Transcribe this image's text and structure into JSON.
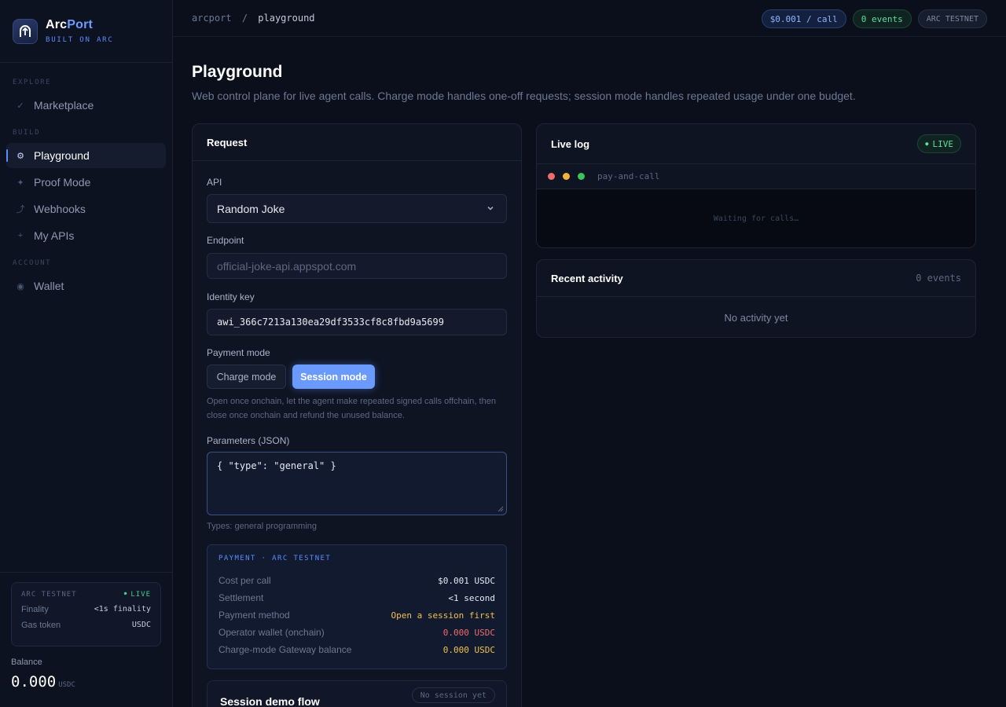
{
  "brand": {
    "name_a": "Arc",
    "name_b": "Port",
    "tagline": "BUILT ON ARC"
  },
  "nav": {
    "explore_header": "EXPLORE",
    "build_header": "BUILD",
    "account_header": "ACCOUNT",
    "items": [
      {
        "label": "Marketplace",
        "icon": "check-icon"
      },
      {
        "label": "Playground",
        "icon": "gear-icon"
      },
      {
        "label": "Proof Mode",
        "icon": "sparkle-icon"
      },
      {
        "label": "Webhooks",
        "icon": "arrow-icon"
      },
      {
        "label": "My APIs",
        "icon": "plus-icon"
      },
      {
        "label": "Wallet",
        "icon": "wallet-icon"
      }
    ]
  },
  "network": {
    "name": "ARC TESTNET",
    "status": "LIVE",
    "finality_label": "Finality",
    "finality_value": "<1s finality",
    "gas_label": "Gas token",
    "gas_value": "USDC"
  },
  "balance": {
    "label": "Balance",
    "value": "0.000",
    "unit": "USDC"
  },
  "breadcrumb": {
    "root": "arcport",
    "separator": "/",
    "current": "playground"
  },
  "header_pills": {
    "price": "$0.001 / call",
    "events": "0 events",
    "network": "ARC TESTNET"
  },
  "page": {
    "title": "Playground",
    "subtitle": "Web control plane for live agent calls. Charge mode handles one-off requests; session mode handles repeated usage under one budget."
  },
  "request": {
    "title": "Request",
    "api_label": "API",
    "api_value": "Random Joke",
    "endpoint_label": "Endpoint",
    "endpoint_placeholder": "official-joke-api.appspot.com",
    "identity_label": "Identity key",
    "identity_value": "awi_366c7213a130ea29df3533cf8c8fbd9a5699",
    "payment_mode_label": "Payment mode",
    "charge_mode": "Charge mode",
    "session_mode": "Session mode",
    "mode_help": "Open once onchain, let the agent make repeated signed calls offchain, then close once onchain and refund the unused balance.",
    "params_label": "Parameters (JSON)",
    "params_value": "{ \"type\": \"general\" }",
    "types_note": "Types: general programming"
  },
  "payment": {
    "title": "PAYMENT · ARC TESTNET",
    "rows": [
      {
        "label": "Cost per call",
        "value": "$0.001 USDC"
      },
      {
        "label": "Settlement",
        "value": "<1 second"
      },
      {
        "label": "Payment method",
        "value": "Open a session first"
      },
      {
        "label": "Operator wallet (onchain)",
        "value": "0.000 USDC"
      },
      {
        "label": "Charge-mode Gateway balance",
        "value": "0.000 USDC"
      }
    ],
    "colors": {
      "warn": "#f2c14e",
      "danger": "#f06b6b"
    }
  },
  "session_demo": {
    "title": "Session demo flow",
    "status": "No session yet"
  },
  "live_log": {
    "title": "Live log",
    "badge": "LIVE",
    "terminal_name": "pay-and-call",
    "empty": "Waiting for calls…"
  },
  "activity": {
    "title": "Recent activity",
    "count": "0 events",
    "empty": "No activity yet"
  },
  "colors": {
    "accent": "#5b8cff",
    "live": "#3ecf8e",
    "background": "#0b0f1b"
  }
}
